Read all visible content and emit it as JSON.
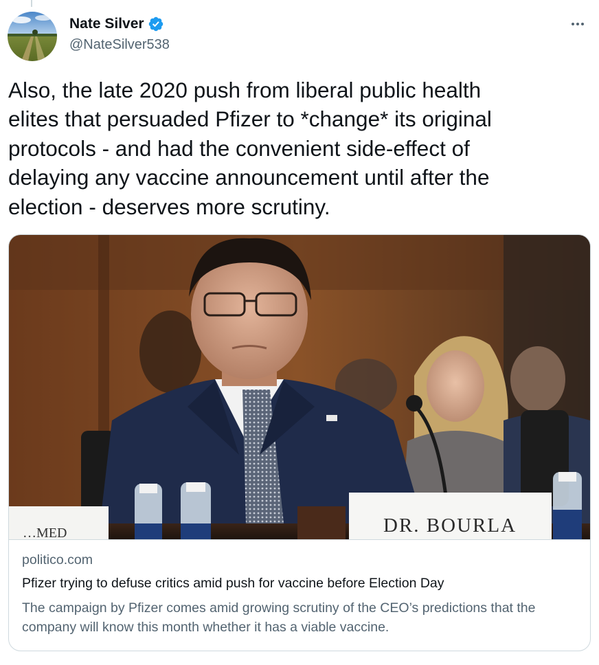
{
  "tweet": {
    "author": {
      "display_name": "Nate Silver",
      "handle": "@NateSilver538",
      "verified": true,
      "verified_color": "#1d9bf0"
    },
    "more_icon": "more-horizontal-icon",
    "text": "Also, the late 2020 push from liberal public health\nelites that persuaded Pfizer to *change* its original\nprotocols - and had the convenient side-effect of\ndelaying any vaccine announcement until after the\nelection - deserves more scrutiny.",
    "link_card": {
      "domain": "politico.com",
      "title": "Pfizer trying to defuse critics amid push for vaccine before Election Day",
      "description": "The campaign by Pfizer comes amid growing scrutiny of the CEO’s predictions that the company will know this month whether it has a viable vaccine.",
      "image": {
        "nameplate_text": "DR. BOURLA",
        "left_nameplate_text": "…MED"
      }
    }
  }
}
